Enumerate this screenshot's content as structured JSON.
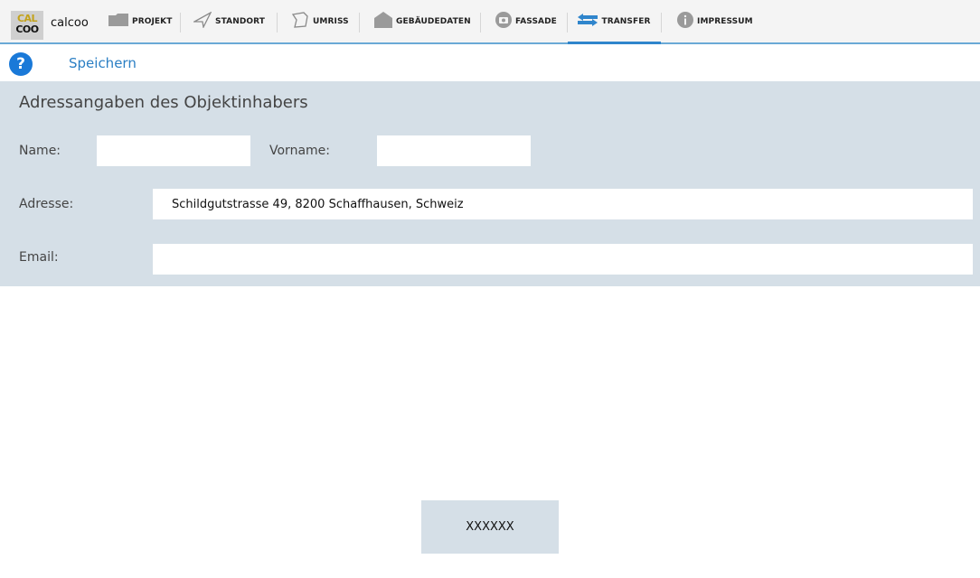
{
  "app": {
    "logo_top": "CAL",
    "logo_bottom": "COO",
    "name": "calcoo"
  },
  "nav": {
    "items": [
      {
        "label": "PROJEKT",
        "icon": "folder-icon"
      },
      {
        "label": "STANDORT",
        "icon": "location-arrow-icon"
      },
      {
        "label": "UMRISS",
        "icon": "outline-icon"
      },
      {
        "label": "GEBÄUDEDATEN",
        "icon": "house-icon"
      },
      {
        "label": "FASSADE",
        "icon": "camera-icon"
      },
      {
        "label": "TRANSFER",
        "icon": "transfer-arrows-icon",
        "active": true
      },
      {
        "label": "IMPRESSUM",
        "icon": "info-icon"
      }
    ]
  },
  "toolbar": {
    "help_label": "?",
    "save_label": "Speichern"
  },
  "form": {
    "title": "Adressangaben des Objektinhabers",
    "name_label": "Name:",
    "name_value": "",
    "vorname_label": "Vorname:",
    "vorname_value": "",
    "adresse_label": "Adresse:",
    "adresse_value": "Schildgutstrasse 49, 8200 Schaffhausen, Schweiz",
    "email_label": "Email:",
    "email_value": ""
  },
  "bottom_button": {
    "label": "XXXXXX"
  },
  "colors": {
    "accent": "#2f85cc",
    "panel": "#d5dfe7"
  }
}
